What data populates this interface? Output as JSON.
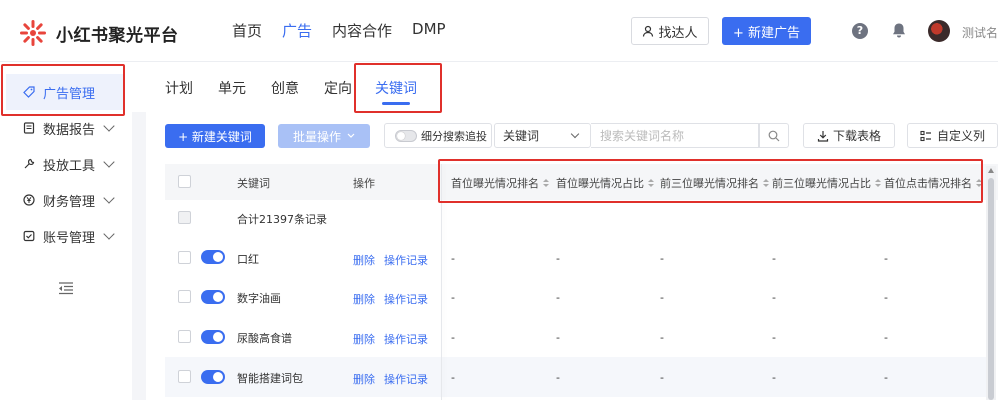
{
  "app": {
    "name": "小红书聚光平台"
  },
  "topnav": [
    {
      "label": "首页",
      "active": false
    },
    {
      "label": "广告",
      "active": true
    },
    {
      "label": "内容合作",
      "active": false
    },
    {
      "label": "DMP",
      "active": false
    }
  ],
  "header": {
    "find_label": "找达人",
    "new_ad_label": "+ 新建广告",
    "help_glyph": "?",
    "username": "测试名"
  },
  "sidebar": {
    "items": [
      {
        "label": "广告管理",
        "icon": "tag-icon",
        "active": true
      },
      {
        "label": "数据报告",
        "icon": "report-icon",
        "active": false
      },
      {
        "label": "投放工具",
        "icon": "tool-icon",
        "active": false
      },
      {
        "label": "财务管理",
        "icon": "yen-icon",
        "active": false
      },
      {
        "label": "账号管理",
        "icon": "account-icon",
        "active": false
      }
    ]
  },
  "tabs": [
    {
      "label": "计划"
    },
    {
      "label": "单元"
    },
    {
      "label": "创意"
    },
    {
      "label": "定向"
    },
    {
      "label": "关键词",
      "active": true
    }
  ],
  "toolbar": {
    "add_keyword_label": "+ 新建关键词",
    "batch_label": "批量操作",
    "fine_search_label": "细分搜索追投",
    "select_value": "关键词",
    "search_placeholder": "搜索关键词名称",
    "download_label": "下载表格",
    "custom_columns_label": "自定义列"
  },
  "table": {
    "fixed_headers": {
      "keyword": "关键词",
      "action": "操作"
    },
    "metric_headers": [
      "首位曝光情况排名",
      "首位曝光情况占比",
      "前三位曝光情况排名",
      "前三位曝光情况占比",
      "首位点击情况排名"
    ],
    "summary": "合计21397条记录",
    "rows": [
      {
        "keyword": "口红",
        "delete": "删除",
        "log": "操作记录",
        "values": [
          "-",
          "-",
          "-",
          "-",
          "-"
        ]
      },
      {
        "keyword": "数字油画",
        "delete": "删除",
        "log": "操作记录",
        "values": [
          "-",
          "-",
          "-",
          "-",
          "-"
        ]
      },
      {
        "keyword": "尿酸高食谱",
        "delete": "删除",
        "log": "操作记录",
        "values": [
          "-",
          "-",
          "-",
          "-",
          "-"
        ]
      },
      {
        "keyword": "智能搭建词包",
        "delete": "删除",
        "log": "操作记录",
        "values": [
          "-",
          "-",
          "-",
          "-",
          "-"
        ]
      }
    ]
  },
  "colors": {
    "accent": "#3a6df0",
    "highlight_box": "#e0302b",
    "batch_disabled": "#a9c1f6"
  }
}
